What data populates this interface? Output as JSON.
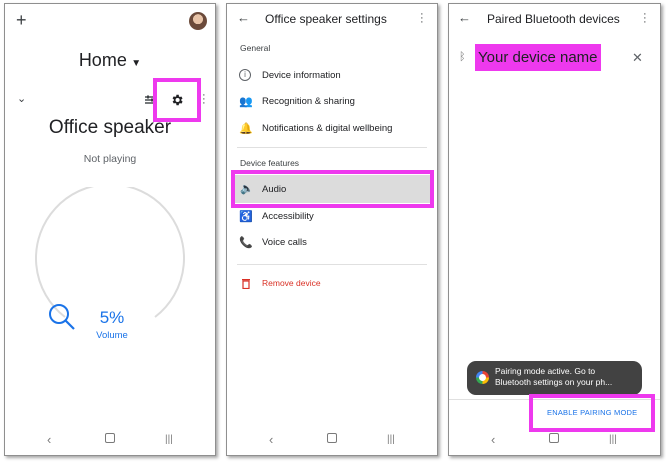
{
  "colors": {
    "accent": "#1a73e8",
    "highlight": "#ee39ee",
    "danger": "#d93025",
    "toast_bg": "#424242"
  },
  "panel_home": {
    "add_icon": "+",
    "room_title": "Home",
    "device_name": "Office speaker",
    "status": "Not playing",
    "volume_value": "5%",
    "volume_label": "Volume",
    "volume_level": 0.05
  },
  "panel_settings": {
    "title": "Office speaker settings",
    "section_general": "General",
    "general_items": [
      {
        "label": "Device information"
      },
      {
        "label": "Recognition & sharing"
      },
      {
        "label": "Notifications & digital wellbeing"
      }
    ],
    "section_features": "Device features",
    "feature_items": [
      {
        "label": "Audio"
      },
      {
        "label": "Accessibility"
      },
      {
        "label": "Voice calls"
      }
    ],
    "remove_label": "Remove device"
  },
  "panel_bluetooth": {
    "title": "Paired Bluetooth devices",
    "device_name": "Your device name",
    "toast_text": "Pairing mode active. Go to Bluetooth settings on your ph...",
    "enable_button": "ENABLE PAIRING MODE"
  }
}
